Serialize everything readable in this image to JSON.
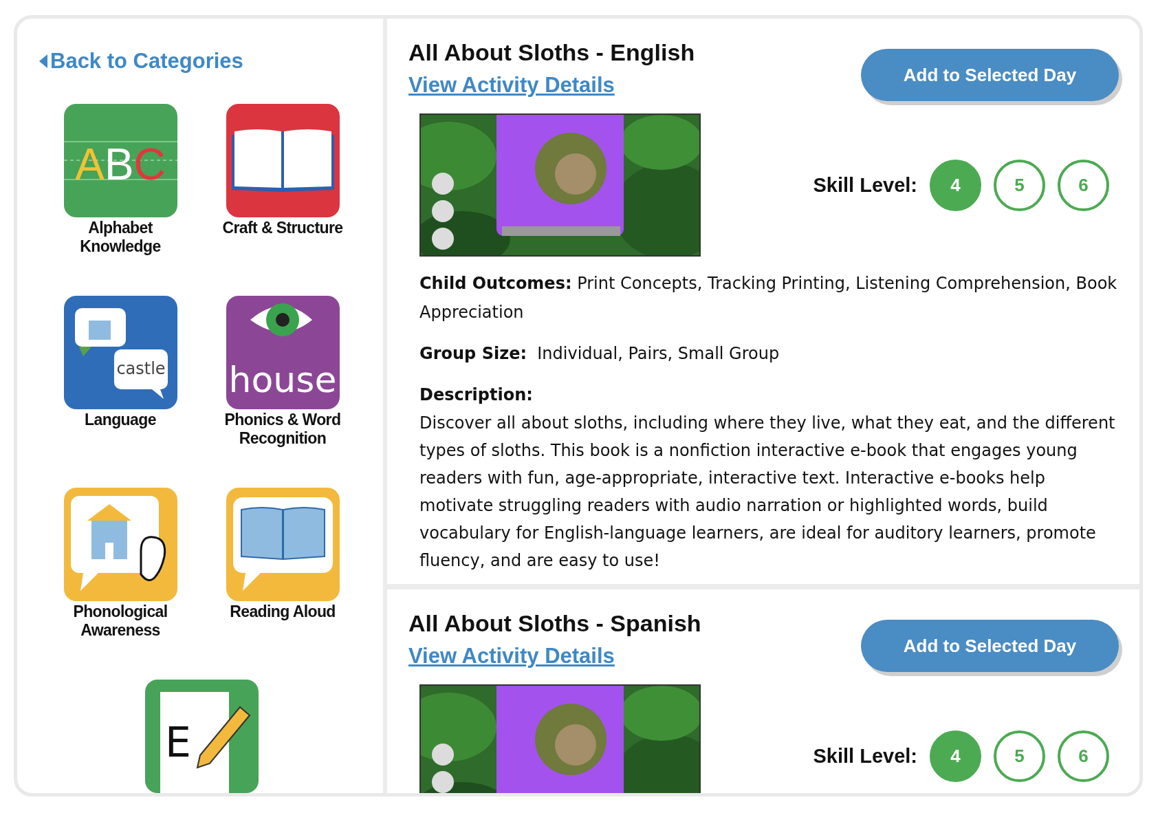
{
  "back_link": "Back to Categories",
  "categories": [
    {
      "kind": "alphabet",
      "label": "Alphabet Knowledge",
      "icon_text": "ABC"
    },
    {
      "kind": "craft",
      "label": "Craft & Structure"
    },
    {
      "kind": "language",
      "label": "Language",
      "icon_text": "castle"
    },
    {
      "kind": "phonics",
      "label": "Phonics & Word Recognition",
      "icon_text": "house"
    },
    {
      "kind": "phonological",
      "label": "Phonological Awareness"
    },
    {
      "kind": "reading",
      "label": "Reading Aloud"
    },
    {
      "kind": "writing",
      "icon_text": "E"
    }
  ],
  "activities": [
    {
      "title": "All About Sloths - English",
      "link": "View Activity Details",
      "button": "Add to Selected Day",
      "skill_label": "Skill Level:",
      "levels": [
        {
          "label": "4",
          "selected": true
        },
        {
          "label": "5",
          "selected": false
        },
        {
          "label": "6",
          "selected": false
        }
      ],
      "outcomes_label": "Child Outcomes:",
      "outcomes": "Print Concepts, Tracking Printing, Listening Comprehension, Book Appreciation",
      "group_label": "Group Size:",
      "group": "Individual, Pairs, Small Group",
      "description_label": "Description:",
      "description": "Discover all about sloths, including where they live, what they eat, and the different types of sloths. This book is a nonfiction interactive e-book that engages young readers with fun, age-appropriate, interactive text. Interactive e-books help motivate struggling readers with audio narration or highlighted words, build vocabulary for English-language learners, are ideal for auditory learners, promote fluency, and are easy to use!"
    },
    {
      "title": "All About Sloths - Spanish",
      "link": "View Activity Details",
      "button": "Add to Selected Day",
      "skill_label": "Skill Level:",
      "levels": [
        {
          "label": "4",
          "selected": true
        },
        {
          "label": "5",
          "selected": false
        },
        {
          "label": "6",
          "selected": false
        }
      ]
    }
  ]
}
